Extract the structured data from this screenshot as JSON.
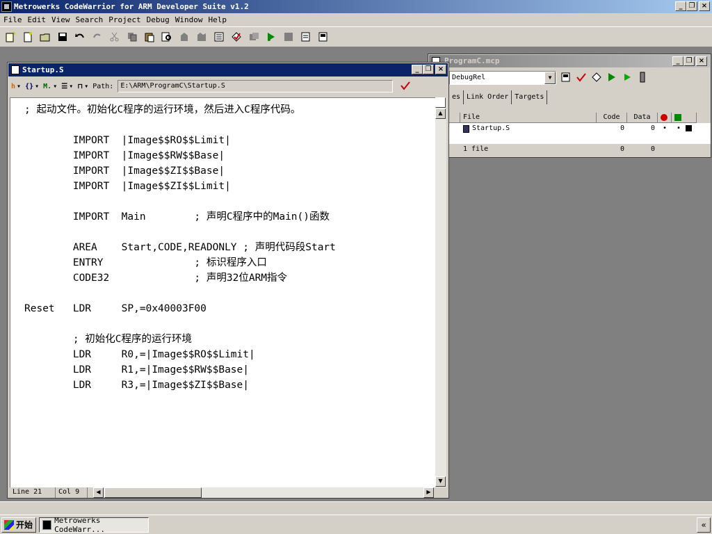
{
  "app": {
    "title": "Metrowerks CodeWarrior for ARM Developer Suite v1.2",
    "window_buttons": [
      "_",
      "❐",
      "×"
    ]
  },
  "menu": {
    "items": [
      "File",
      "Edit",
      "View",
      "Search",
      "Project",
      "Debug",
      "Window",
      "Help"
    ]
  },
  "toolbar": {
    "icons": [
      "new-project-icon",
      "new-file-icon",
      "open-icon",
      "save-icon",
      "undo-icon",
      "redo-icon",
      "cut-icon",
      "copy-icon",
      "paste-icon",
      "find-icon",
      "find-next-icon",
      "compile-icon",
      "bring-up-to-date-icon",
      "project-icon",
      "make-icon",
      "stop-icon",
      "run-icon",
      "debug-icon",
      "settings-icon",
      "window-icon",
      "target-settings-icon"
    ]
  },
  "editor": {
    "title": "Startup.S",
    "path_label": "Path:",
    "path_value": "E:\\ARM\\ProgramC\\Startup.S",
    "toolbar_symbols": [
      "h",
      "{}",
      "M.",
      "☰",
      "🔒"
    ],
    "code_lines": [
      "; 起动文件。初始化C程序的运行环境，然后进入C程序代码。",
      "",
      "        IMPORT  |Image$$RO$$Limit|",
      "        IMPORT  |Image$$RW$$Base|",
      "        IMPORT  |Image$$ZI$$Base|",
      "        IMPORT  |Image$$ZI$$Limit|",
      "",
      "        IMPORT  Main        ; 声明C程序中的Main()函数",
      "",
      "        AREA    Start,CODE,READONLY ; 声明代码段Start",
      "        ENTRY               ; 标识程序入口",
      "        CODE32              ; 声明32位ARM指令",
      "",
      "Reset   LDR     SP,=0x40003F00",
      "",
      "        ; 初始化C程序的运行环境",
      "        LDR     R0,=|Image$$RO$$Limit|",
      "        LDR     R1,=|Image$$RW$$Base|",
      "        LDR     R3,=|Image$$ZI$$Base|"
    ],
    "status": {
      "line": "Line 21",
      "col": "Col 9"
    }
  },
  "project": {
    "title": "ProgramC.mcp",
    "target": "DebugRel",
    "tabs": [
      "es",
      "Link Order",
      "Targets"
    ],
    "columns": [
      "File",
      "Code",
      "Data"
    ],
    "files": [
      {
        "name": "Startup.S",
        "code": "0",
        "data": "0",
        "flag1": "•",
        "flag2": "•"
      }
    ],
    "footer": {
      "count": "1 file",
      "code": "0",
      "data": "0"
    }
  },
  "taskbar": {
    "start_label": "开始",
    "task_label": "Metrowerks CodeWarr...",
    "tray_symbol": "«"
  },
  "colors": {
    "title_active": "#0a246a",
    "title_inactive": "#808080",
    "face": "#d4d0c8",
    "desktop": "#808080"
  }
}
